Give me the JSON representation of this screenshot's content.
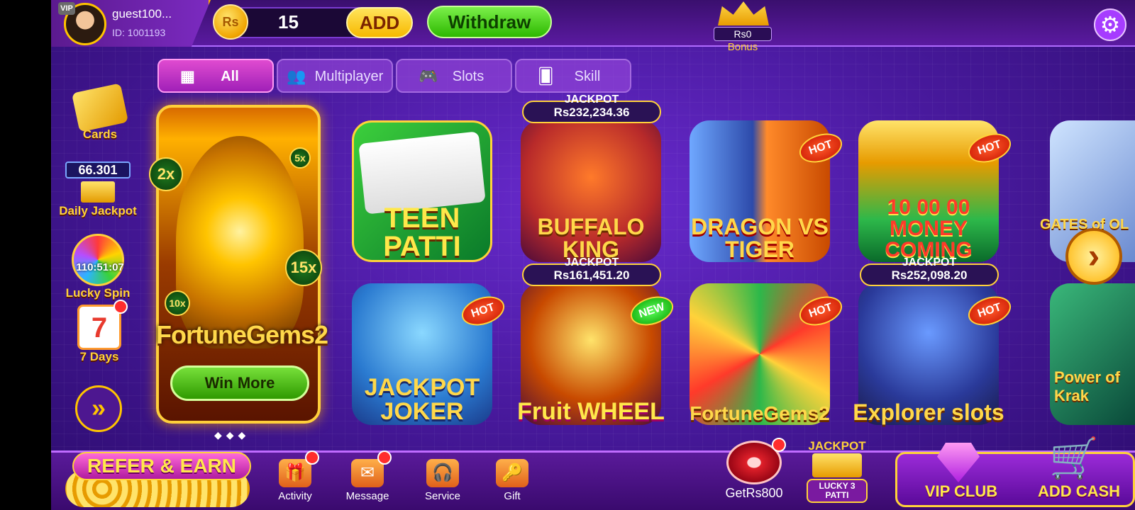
{
  "header": {
    "vip_badge": "VIP",
    "username": "guest100...",
    "user_id": "ID: 1001193",
    "currency_symbol": "Rs",
    "balance": "15",
    "add_label": "ADD",
    "withdraw_label": "Withdraw",
    "bonus_amount": "Rs0",
    "bonus_label": "Bonus"
  },
  "tabs": [
    {
      "label": "All",
      "active": true
    },
    {
      "label": "Multiplayer",
      "active": false
    },
    {
      "label": "Slots",
      "active": false
    },
    {
      "label": "Skill",
      "active": false
    }
  ],
  "left_rail": {
    "cards_label": "Cards",
    "jackpot_value": "66.301",
    "jackpot_label": "Daily Jackpot",
    "lucky_spin_timer": "110:51:07",
    "lucky_spin_label": "Lucky Spin",
    "seven_days_label": "7 Days"
  },
  "featured": {
    "title": "FortuneGems2",
    "button": "Win More",
    "multipliers": [
      "2x",
      "5x",
      "15x",
      "10x"
    ]
  },
  "games": [
    {
      "name": "TEEN PATTI",
      "jackpot_label": "",
      "jackpot": "",
      "badge": ""
    },
    {
      "name": "BUFFALO KING",
      "jackpot_label": "JACKPOT",
      "jackpot": "Rs232,234.36",
      "badge": ""
    },
    {
      "name": "DRAGON VS TIGER",
      "jackpot_label": "",
      "jackpot": "",
      "badge": "HOT"
    },
    {
      "name": "10 00 00 MONEY COMING",
      "jackpot_label": "",
      "jackpot": "",
      "badge": "HOT"
    },
    {
      "name": "JACKPOT JOKER",
      "jackpot_label": "",
      "jackpot": "",
      "badge": "HOT"
    },
    {
      "name": "Fruit WHEEL",
      "jackpot_label": "JACKPOT",
      "jackpot": "Rs161,451.20",
      "badge": "NEW"
    },
    {
      "name": "FortuneGems2",
      "jackpot_label": "",
      "jackpot": "",
      "badge": "HOT"
    },
    {
      "name": "Explorer slots",
      "jackpot_label": "JACKPOT",
      "jackpot": "Rs252,098.20",
      "badge": "HOT"
    }
  ],
  "partial_games": [
    "GATES of OL",
    "Power of Krak"
  ],
  "bottom": {
    "refer_label": "REFER & EARN",
    "nav": [
      "Activity",
      "Message",
      "Service",
      "Gift"
    ],
    "getrs_label": "GetRs800",
    "lucky_jackpot": "JACKPOT",
    "lucky_label": "LUCKY 3 PATTI",
    "vip_label": "VIP CLUB",
    "add_cash_label": "ADD CASH"
  },
  "icons": {
    "settings": "gear-icon",
    "tab_all": "grid-icon",
    "tab_multiplayer": "people-icon",
    "tab_slots": "gamepad-icon",
    "tab_skill": "cards-icon"
  },
  "colors": {
    "background": "#4a1aa0",
    "accent_gold": "#ffc400",
    "add_button": "#f7b800",
    "withdraw_button": "#2db800",
    "active_tab": "#c030c8"
  }
}
